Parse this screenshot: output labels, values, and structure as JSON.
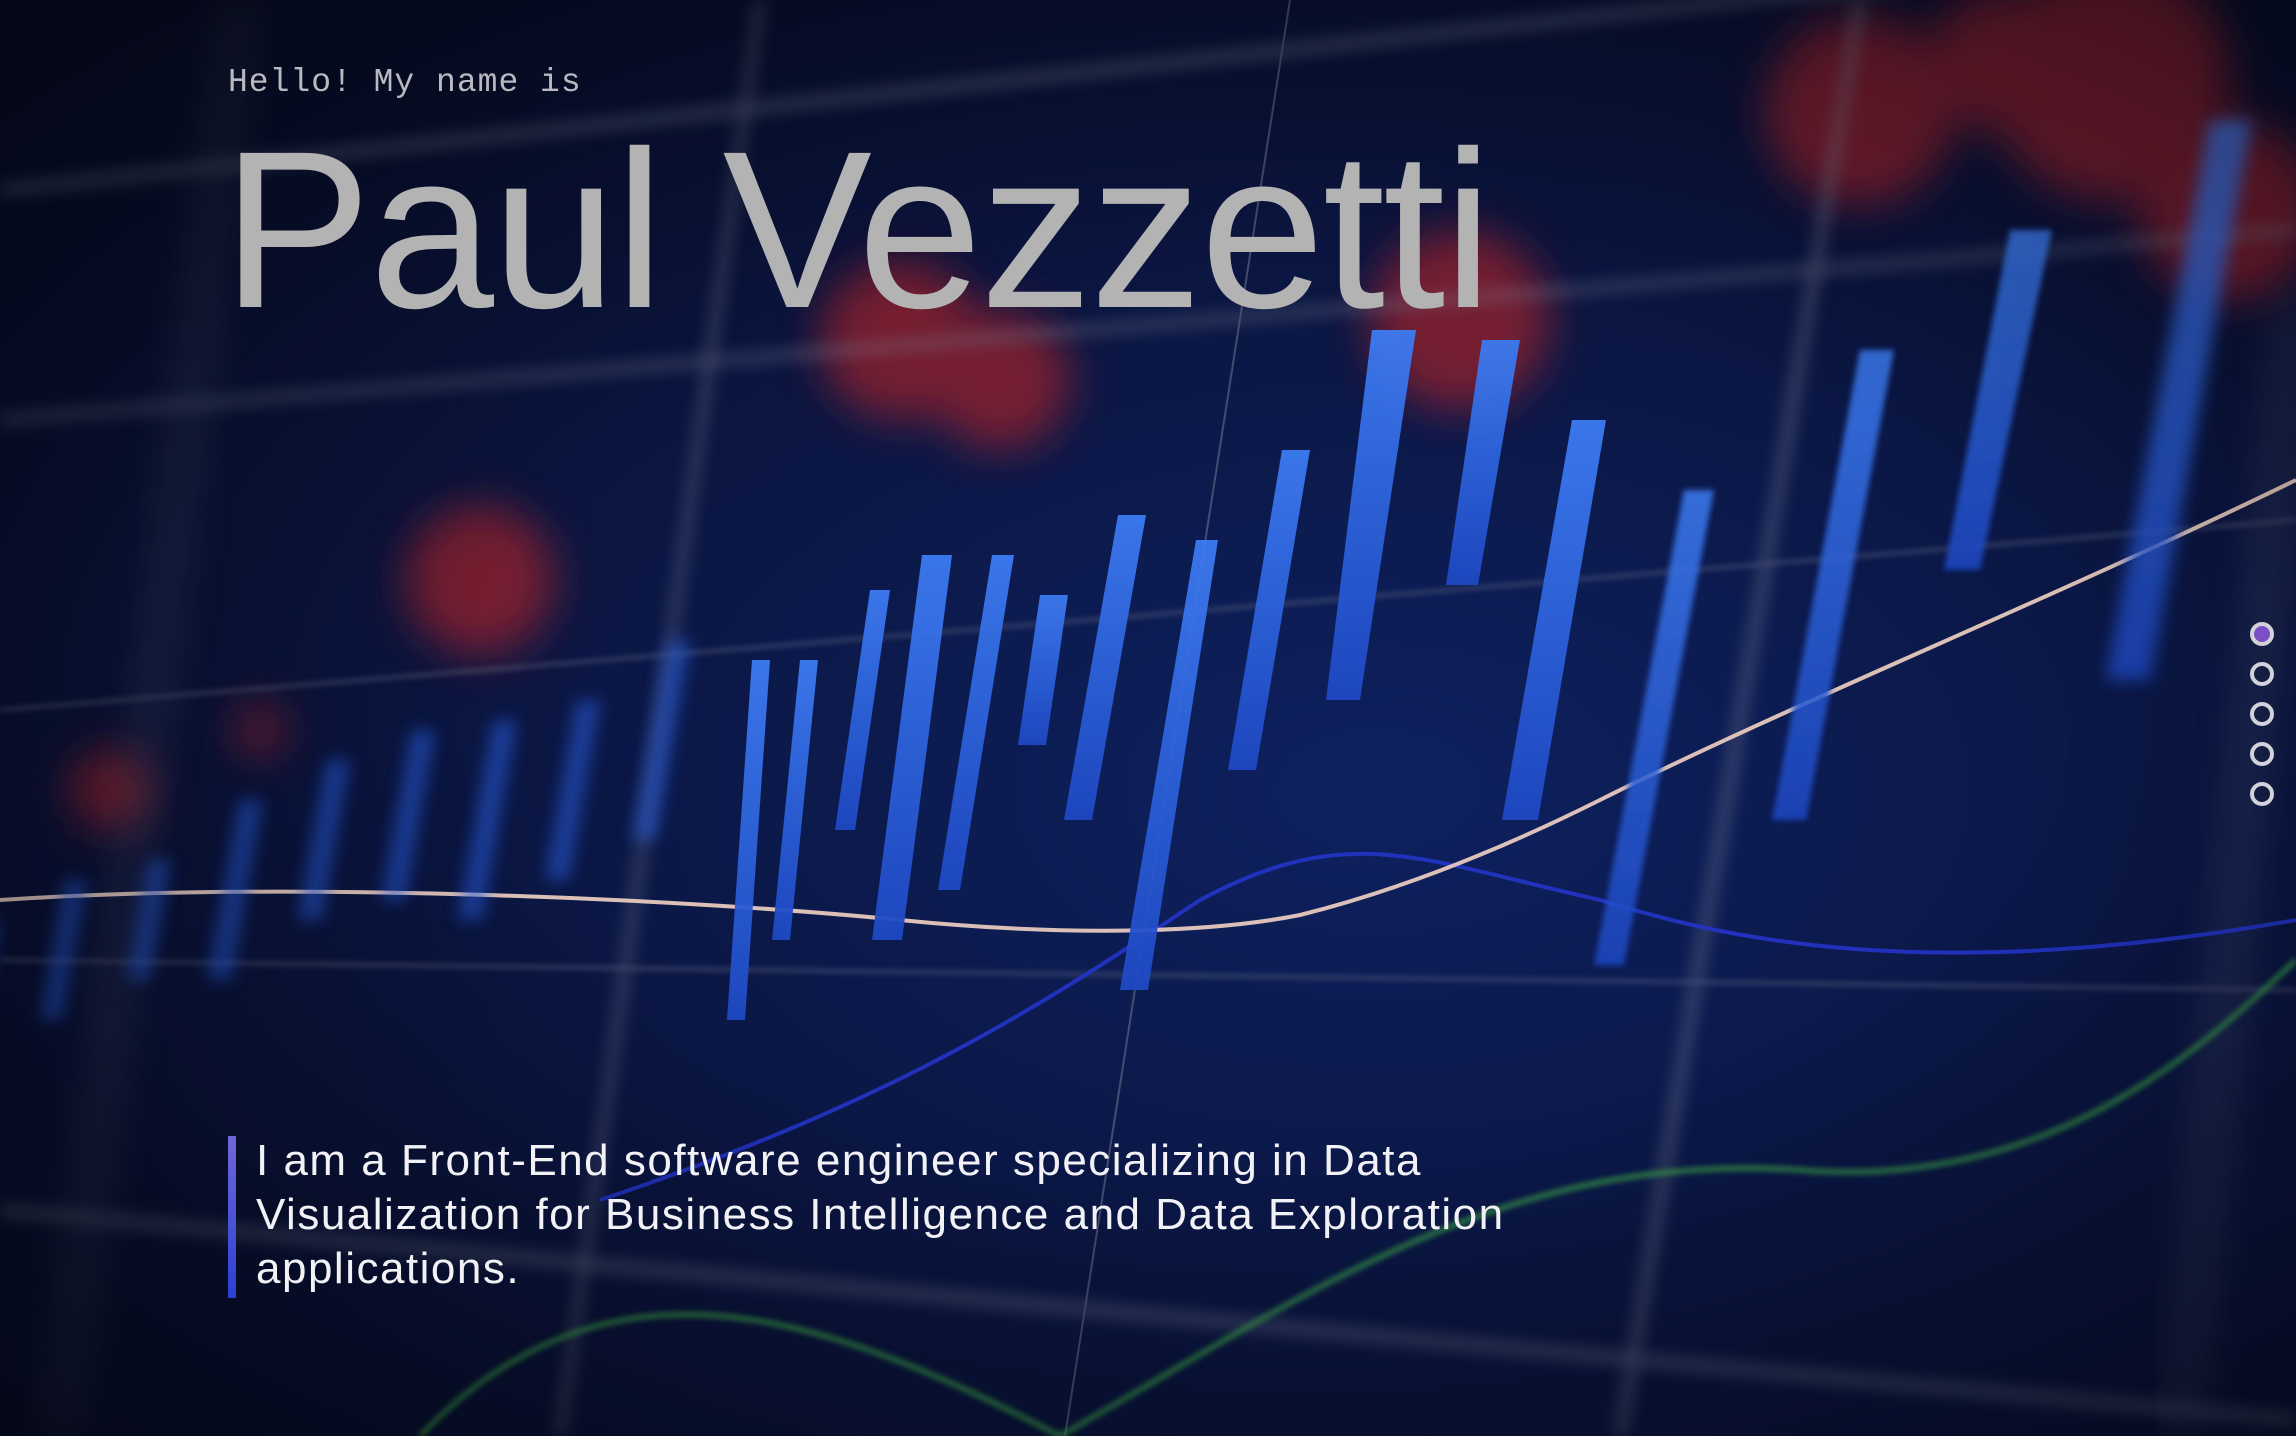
{
  "hero": {
    "greeting": "Hello! My name is",
    "name": "Paul Vezzetti",
    "tagline": "I am a Front-End software engineer specializing in Data Visualization for Business Intelligence and Data Exploration applications."
  },
  "section_nav": {
    "active_index": 0,
    "count": 5
  },
  "colors": {
    "accent": "#7a4fc6",
    "tagline_bar_top": "#6f67d8",
    "tagline_bar_bottom": "#2b40d4",
    "background": "#0b1848",
    "name_text": "#b3b3b3"
  }
}
